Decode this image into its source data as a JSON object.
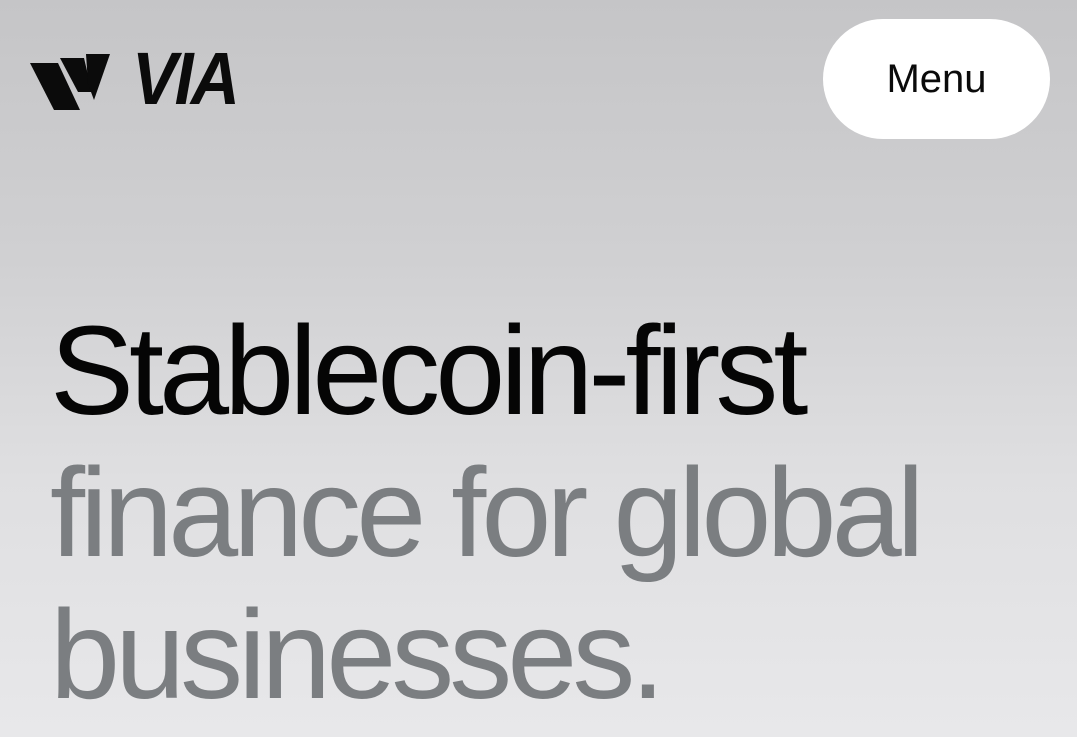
{
  "header": {
    "brand": {
      "logo_icon": "via-logo-mark",
      "name": "VIA"
    },
    "menu_label": "Menu"
  },
  "hero": {
    "headline_lines": [
      {
        "text": "Stablecoin-first",
        "tone": "dark"
      },
      {
        "text": "finance for global",
        "tone": "muted"
      },
      {
        "text": "businesses.",
        "tone": "muted"
      }
    ]
  },
  "colors": {
    "text_dark": "#050505",
    "text_muted": "#7b7e81",
    "button_bg": "#ffffff"
  }
}
